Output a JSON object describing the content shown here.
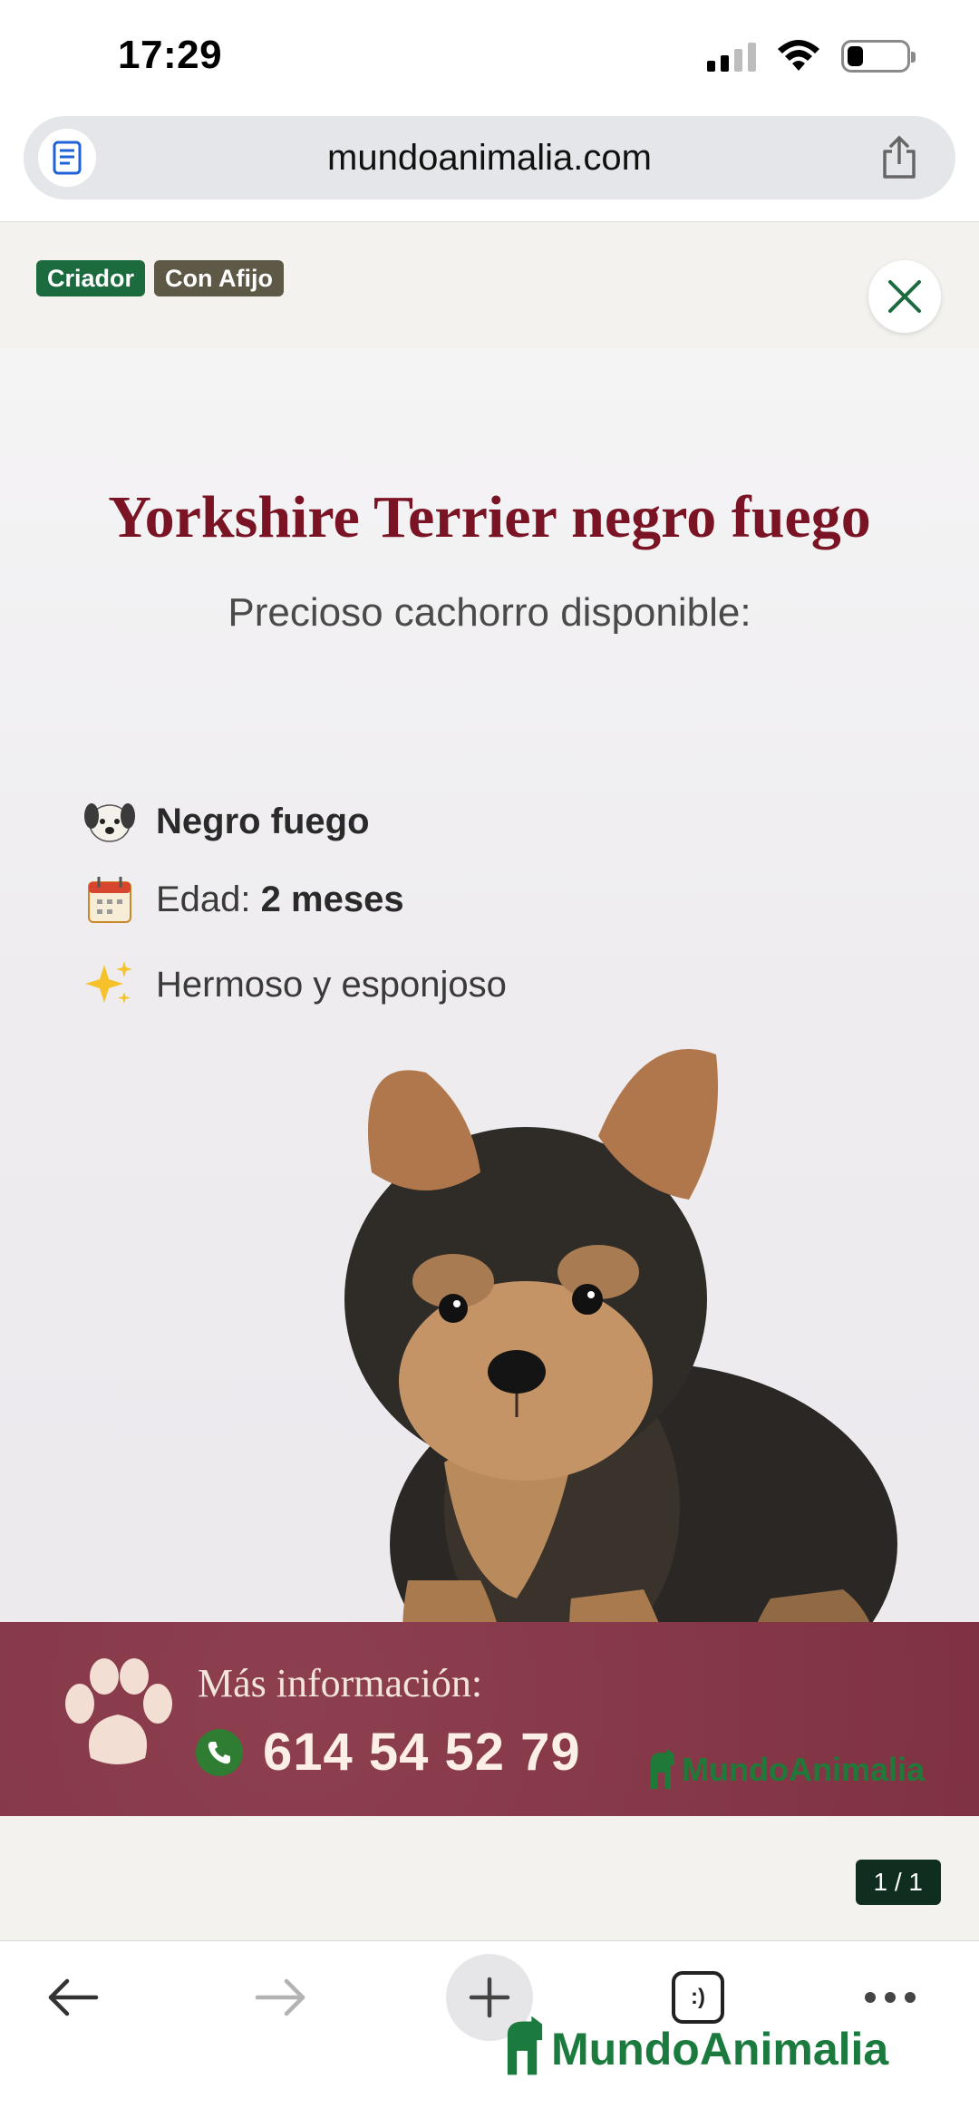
{
  "status_bar": {
    "time": "17:29",
    "icons": [
      "cellular-signal-icon",
      "wifi-icon",
      "battery-icon"
    ]
  },
  "browser": {
    "url": "mundoanimalia.com",
    "reader_icon": "reader-mode-icon",
    "share_icon": "share-icon"
  },
  "listing": {
    "tags": [
      "Criador",
      "Con Afijo"
    ],
    "close_icon": "close-icon",
    "counter": "1 / 1"
  },
  "ad": {
    "title": "Yorkshire Terrier negro fuego",
    "subtitle": "Precioso cachorro disponible:",
    "features": [
      {
        "icon": "dog-face-icon",
        "bold": "Negro fuego",
        "text": ""
      },
      {
        "icon": "calendar-icon",
        "text": "Edad: ",
        "bold": "2 meses"
      },
      {
        "icon": "sparkles-icon",
        "text": "Hermoso y esponjoso",
        "bold": ""
      }
    ],
    "banner": {
      "label": "Más información:",
      "phone": "614 54 52 79",
      "brand": "MundoAnimalia"
    }
  },
  "toolbar": {
    "buttons": [
      "back-icon",
      "forward-icon",
      "new-tab-icon",
      "tabs-icon",
      "more-icon"
    ],
    "tabs_label": ":)",
    "brand": "MundoAnimalia"
  },
  "colors": {
    "title_red": "#7a1324",
    "banner_bg": "#873546",
    "tag_green": "#1c6b3e",
    "tag_gray": "#5e5947",
    "brand_green": "#1b7a3d",
    "counter_bg": "#0f2e1f"
  }
}
